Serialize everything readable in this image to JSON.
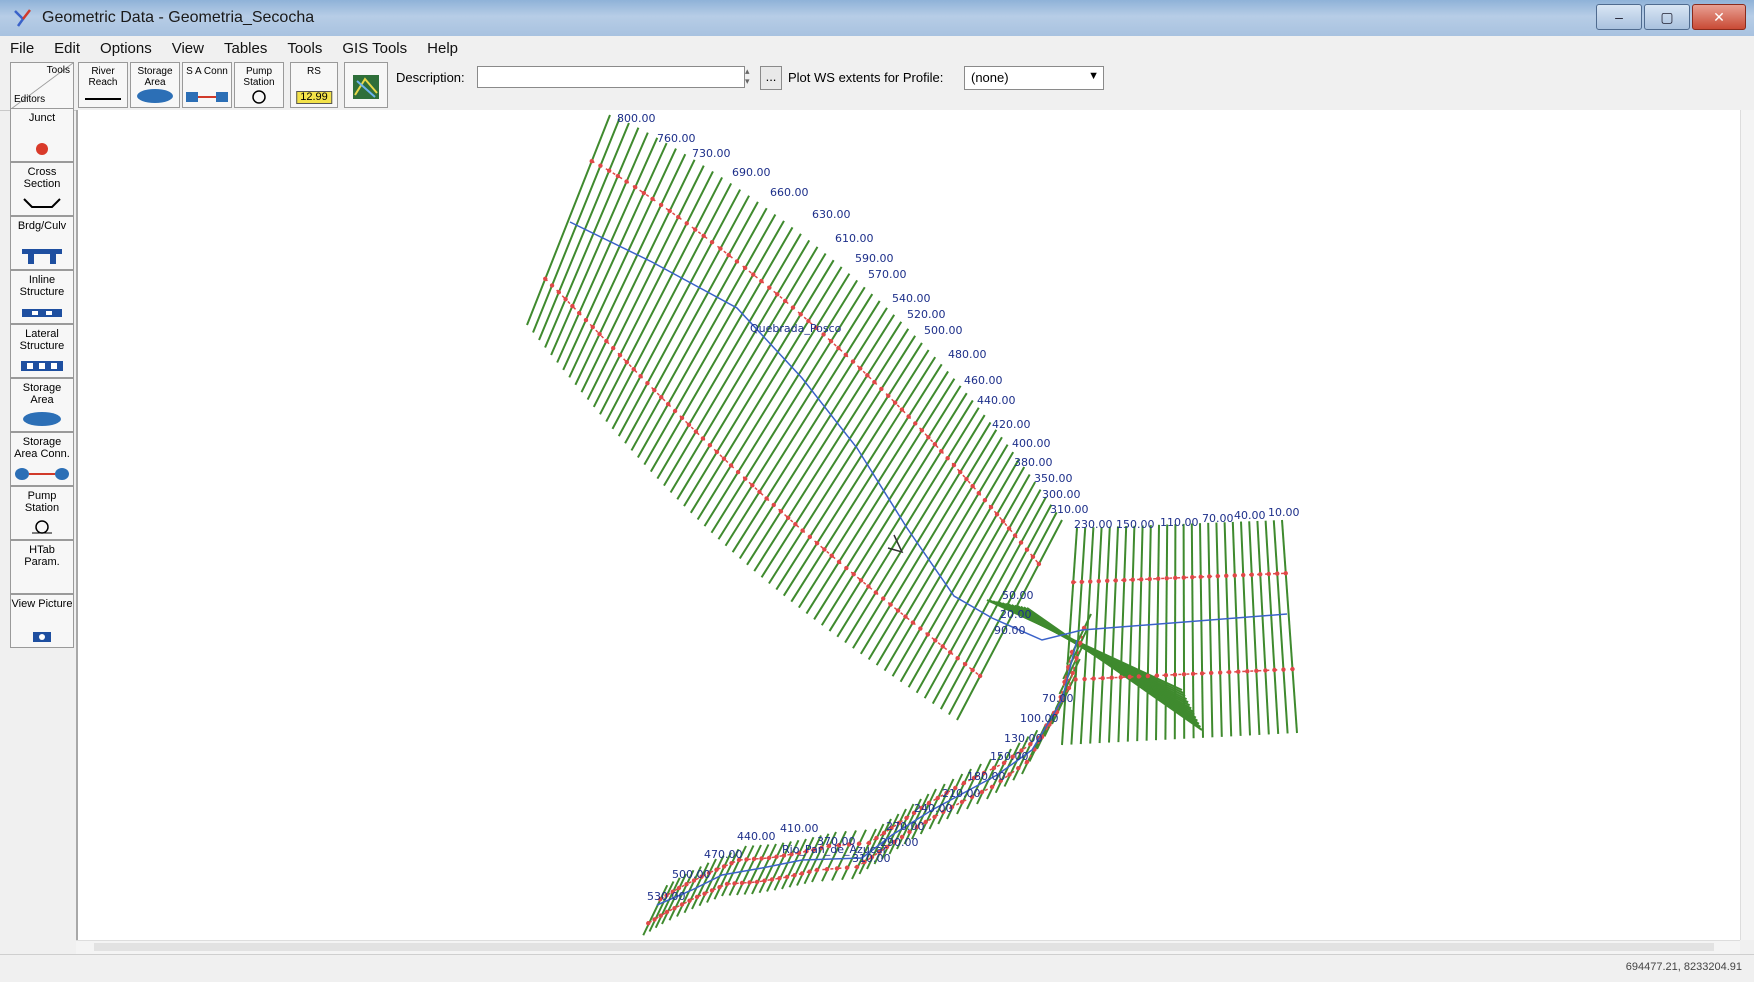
{
  "window": {
    "title": "Geometric Data - Geometria_Secocha",
    "minimize": "–",
    "maximize": "▢",
    "close": "✕"
  },
  "menu": [
    "File",
    "Edit",
    "Options",
    "View",
    "Tables",
    "Tools",
    "GIS Tools",
    "Help"
  ],
  "toolbar": {
    "editors_tools": "Tools",
    "editors_label": "Editors",
    "river_reach": "River Reach",
    "storage_area": "Storage Area",
    "sa_conn": "S A Conn",
    "pump_station": "Pump Station",
    "rs": "RS",
    "rs_value": "12.99",
    "description_label": "Description:",
    "description_value": "",
    "ellipsis": "...",
    "plot_ws_label": "Plot WS extents for Profile:",
    "profile_value": "(none)"
  },
  "palette": [
    {
      "label": "Junct",
      "icon": "junction-icon"
    },
    {
      "label": "Cross Section",
      "icon": "cross-section-icon"
    },
    {
      "label": "Brdg/Culv",
      "icon": "bridge-icon"
    },
    {
      "label": "Inline Structure",
      "icon": "inline-structure-icon"
    },
    {
      "label": "Lateral Structure",
      "icon": "lateral-structure-icon"
    },
    {
      "label": "Storage Area",
      "icon": "storage-area-icon"
    },
    {
      "label": "Storage Area Conn.",
      "icon": "storage-area-conn-icon"
    },
    {
      "label": "Pump Station",
      "icon": "pump-station-icon"
    },
    {
      "label": "HTab Param.",
      "icon": ""
    },
    {
      "label": "View Picture",
      "icon": "camera-icon"
    }
  ],
  "map": {
    "reach1_name": "Quebrada_Posco",
    "reach2_name": "Rio_Pan_de_Azucar",
    "reach1_labels": [
      "800.00",
      "760.00",
      "730.00",
      "690.00",
      "660.00",
      "630.00",
      "610.00",
      "590.00",
      "570.00",
      "540.00",
      "520.00",
      "500.00",
      "480.00",
      "460.00",
      "440.00",
      "420.00",
      "400.00",
      "380.00",
      "350.00",
      "300.00",
      "310.00",
      "230.00",
      "150.00",
      "110.00",
      "70.00",
      "40.00",
      "10.00",
      "50.00",
      "20.00",
      "90.00"
    ],
    "reach2_labels": [
      "70.00",
      "100.00",
      "130.00",
      "150.00",
      "180.00",
      "210.00",
      "240.00",
      "270.00",
      "290.00",
      "370.00",
      "310.00",
      "410.00",
      "440.00",
      "470.00",
      "500.00",
      "530.00"
    ]
  },
  "status": {
    "coordinates": "694477.21, 8233204.91"
  },
  "colors": {
    "xs_green": "#3f8a2e",
    "bank_red": "#e04848",
    "stream_blue": "#3a62c9",
    "label_blue": "#1d2f8a"
  }
}
